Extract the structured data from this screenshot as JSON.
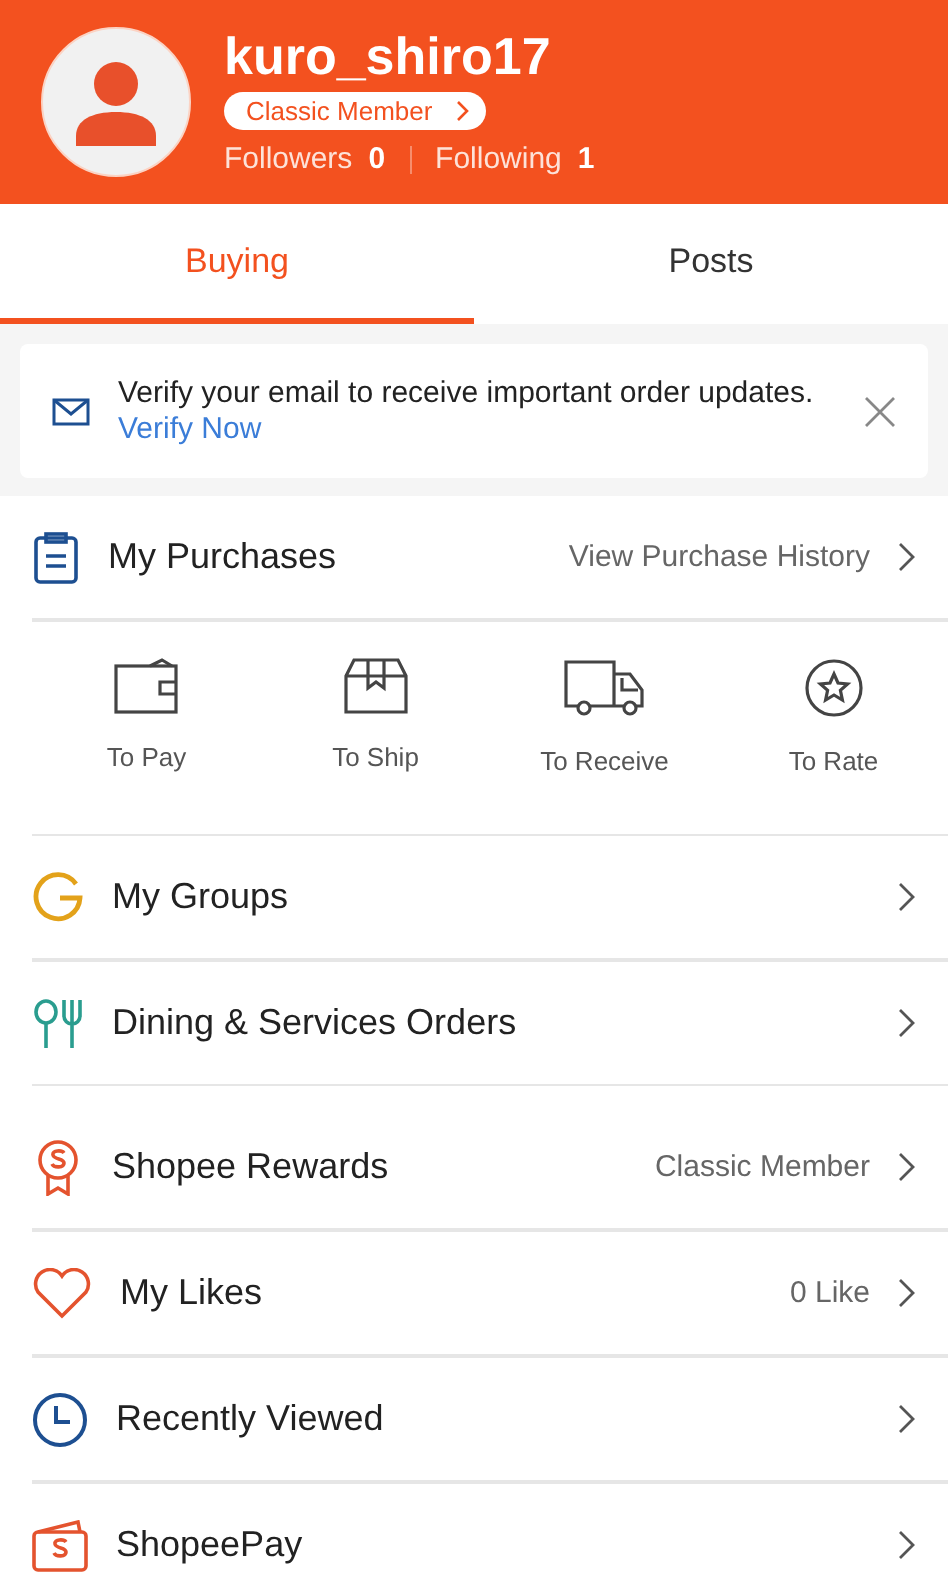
{
  "profile": {
    "username": "kuro_shiro17",
    "membership": "Classic Member",
    "stats": [
      {
        "label": "Followers",
        "value": "0"
      },
      {
        "label": "Following",
        "value": "1"
      }
    ]
  },
  "tabs": [
    {
      "label": "Buying",
      "selected": true
    },
    {
      "label": "Posts",
      "selected": false
    }
  ],
  "notice": {
    "text": "Verify your email to receive important order updates.",
    "link": "Verify Now"
  },
  "purchases": {
    "title": "My Purchases",
    "link": "View Purchase History",
    "statuses": [
      {
        "kind": "pay",
        "label": "To Pay"
      },
      {
        "kind": "ship",
        "label": "To Ship"
      },
      {
        "kind": "receive",
        "label": "To Receive"
      },
      {
        "kind": "rate",
        "label": "To Rate"
      }
    ]
  },
  "menu_groups": [
    [
      {
        "kind": "groups",
        "label": "My Groups"
      },
      {
        "kind": "dining",
        "label": "Dining & Services Orders"
      }
    ],
    [
      {
        "kind": "rewards",
        "label": "Shopee Rewards",
        "value": "Classic Member"
      },
      {
        "kind": "likes",
        "label": "My Likes",
        "value": "0 Like"
      },
      {
        "kind": "recent",
        "label": "Recently Viewed"
      },
      {
        "kind": "shopeepay",
        "label": "ShopeePay"
      }
    ]
  ]
}
